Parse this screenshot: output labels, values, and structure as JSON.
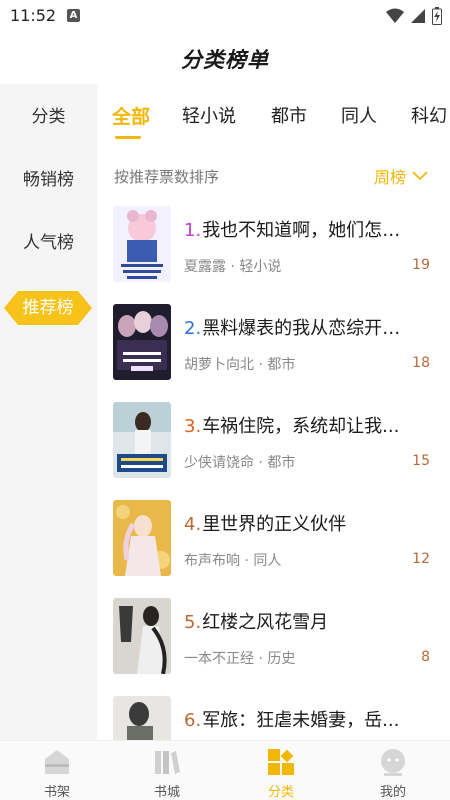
{
  "status_bar": {
    "time": "11:52",
    "notif_letter": "A"
  },
  "title": "分类榜单",
  "sidebar": {
    "items": [
      {
        "label": "分类"
      },
      {
        "label": "畅销榜"
      },
      {
        "label": "人气榜"
      },
      {
        "label": "推荐榜",
        "active": true
      }
    ]
  },
  "tabs": [
    {
      "label": "全部",
      "active": true
    },
    {
      "label": "轻小说"
    },
    {
      "label": "都市"
    },
    {
      "label": "同人"
    },
    {
      "label": "科幻"
    }
  ],
  "sort": {
    "label": "按推荐票数排序",
    "selected": "周榜"
  },
  "books": [
    {
      "rank": "1.",
      "title": "我也不知道啊，她们怎么就...",
      "author": "夏露露",
      "category": "轻小说",
      "votes": "19",
      "rank_color": "#c03bd1"
    },
    {
      "rank": "2.",
      "title": "黑料爆表的我从恋综开始...",
      "author": "胡萝卜向北",
      "category": "都市",
      "votes": "18",
      "rank_color": "#2f6fd6"
    },
    {
      "rank": "3.",
      "title": "车祸住院，系统却让我...",
      "author": "少侠请饶命",
      "category": "都市",
      "votes": "15",
      "rank_color": "#e0621b"
    },
    {
      "rank": "4.",
      "title": "里世界的正义伙伴",
      "author": "布声布响",
      "category": "同人",
      "votes": "12",
      "rank_color": "#b86a3a"
    },
    {
      "rank": "5.",
      "title": "红楼之风花雪月",
      "author": "一本不正经",
      "category": "历史",
      "votes": "8",
      "rank_color": "#b86a3a"
    },
    {
      "rank": "6.",
      "title": "军旅：狂虐未婚妻，岳...",
      "author": "",
      "category": "",
      "votes": "",
      "rank_color": "#b86a3a"
    }
  ],
  "meta_separator": " · ",
  "bottom_nav": [
    {
      "label": "书架"
    },
    {
      "label": "书城"
    },
    {
      "label": "分类",
      "active": true
    },
    {
      "label": "我的"
    }
  ],
  "colors": {
    "accent": "#f2b705",
    "sidebar_bg": "#f5f5f5",
    "vote": "#b86a3a"
  }
}
